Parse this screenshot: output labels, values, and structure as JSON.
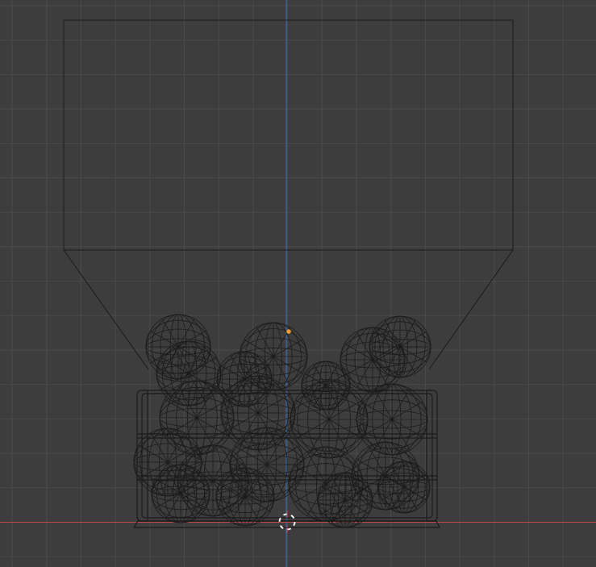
{
  "viewport": {
    "view": "front-orthographic",
    "shading": "wireframe",
    "colors": {
      "background": "#3d3d3d",
      "grid_line": "#4b4b4b",
      "x_axis": "#c0484e",
      "z_axis": "#3b74c8",
      "wireframe": "#1b1b1b",
      "selected_origin": "#f39a28",
      "cursor_red": "#d7373a",
      "cursor_white": "#f2f2f2"
    }
  },
  "scene": {
    "objects": [
      {
        "name": "hopper",
        "icon": "hopper-wireframe-icon"
      },
      {
        "name": "ball-pile",
        "icon": "sphere-wireframe-icon",
        "count": 20
      },
      {
        "name": "crate",
        "icon": "box-wireframe-icon"
      }
    ],
    "cursor_icon": "3d-cursor-icon",
    "origin_icon": "object-origin-icon"
  }
}
